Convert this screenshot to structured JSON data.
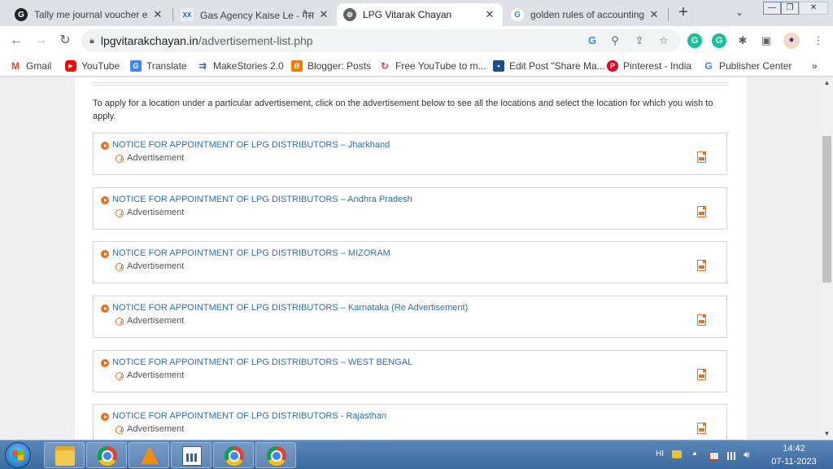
{
  "browser": {
    "tabs": [
      {
        "title": "Tally me journal voucher entr",
        "favicon": "G",
        "favicon_color": "#202124",
        "active": false
      },
      {
        "title": "Gas Agency Kaise Le - गैस एजे",
        "favicon": "XX",
        "favicon_color": "#2b5ba8",
        "active": false
      },
      {
        "title": "LPG Vitarak Chayan",
        "favicon": "globe-icon",
        "favicon_color": "#5f6368",
        "active": true
      },
      {
        "title": "golden rules of accounting in",
        "favicon": "G",
        "favicon_color": "#4285f4",
        "active": false
      }
    ],
    "new_tab_label": "+",
    "address_bar": {
      "domain": "lpgvitarakchayan.in",
      "path": "/advertisement-list.php"
    },
    "bookmarks": [
      {
        "label": "Gmail",
        "icon": "gmail-icon",
        "color": "#ea4335"
      },
      {
        "label": "YouTube",
        "icon": "youtube-icon",
        "color": "#ff0000"
      },
      {
        "label": "Translate",
        "icon": "translate-icon",
        "color": "#4285f4"
      },
      {
        "label": "MakeStories 2.0",
        "icon": "makestories-icon",
        "color": "#3b5bdb"
      },
      {
        "label": "Blogger: Posts",
        "icon": "blogger-icon",
        "color": "#f57c00"
      },
      {
        "label": "Free YouTube to m...",
        "icon": "converter-icon",
        "color": "#e53935"
      },
      {
        "label": "Edit Post \"Share Ma...",
        "icon": "edit-post-icon",
        "color": "#1f4e8c"
      },
      {
        "label": "Pinterest - India",
        "icon": "pinterest-icon",
        "color": "#e60023"
      },
      {
        "label": "Publisher Center",
        "icon": "google-icon",
        "color": "#4285f4"
      }
    ],
    "bookmarks_overflow": "»"
  },
  "page": {
    "intro": "To apply for a location under a particular advertisement, click on the advertisement below to see all the locations and select the location for which you wish to apply.",
    "advertisements": [
      {
        "title": "NOTICE FOR APPOINTMENT OF LPG DISTRIBUTORS – Jharkhand",
        "tag": "Advertisement"
      },
      {
        "title": "NOTICE FOR APPOINTMENT OF LPG DISTRIBUTORS – Andhra Pradesh",
        "tag": "Advertisement"
      },
      {
        "title": "NOTICE FOR APPOINTMENT OF LPG DISTRIBUTORS – MIZORAM",
        "tag": "Advertisement"
      },
      {
        "title": "NOTICE FOR APPOINTMENT OF LPG DISTRIBUTORS – Karnataka (Re Advertisement)",
        "tag": "Advertisement"
      },
      {
        "title": "NOTICE FOR APPOINTMENT OF LPG DISTRIBUTORS – WEST BENGAL",
        "tag": "Advertisement"
      },
      {
        "title": "NOTICE FOR APPOINTMENT OF LPG DISTRIBUTORS - Rajasthan",
        "tag": "Advertisement"
      }
    ],
    "link_color": "#2f6fad",
    "accent_color": "#e8711c"
  },
  "taskbar": {
    "language": "HI",
    "time": "14:42",
    "date": "07-11-2023"
  }
}
